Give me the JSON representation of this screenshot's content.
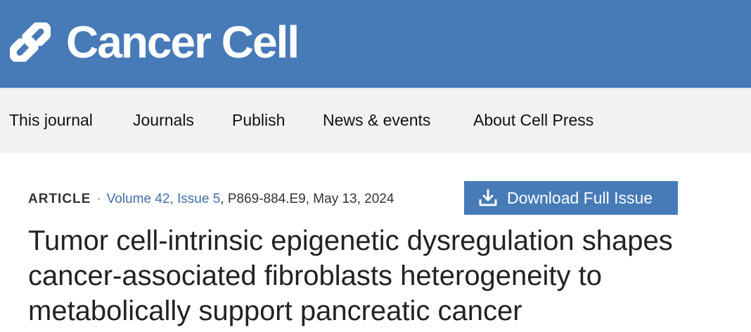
{
  "brand": {
    "logo_icon": "cell-press-logo-icon",
    "name": "Cancer Cell",
    "header_color": "#477bb8"
  },
  "nav": {
    "items": [
      {
        "label": "This journal"
      },
      {
        "label": "Journals"
      },
      {
        "label": "Publish"
      },
      {
        "label": "News & events"
      },
      {
        "label": "About Cell Press"
      }
    ]
  },
  "article": {
    "type": "ARTICLE",
    "separator": "·",
    "issue_link": "Volume 42, Issue 5",
    "pages_date": ", P869-884.E9, May 13, 2024",
    "title": "Tumor cell-intrinsic epigenetic dysregulation shapes cancer-associated fibroblasts heterogeneity to metabolically support pancreatic cancer"
  },
  "actions": {
    "download_icon": "download-icon",
    "download_label": "Download Full Issue"
  }
}
